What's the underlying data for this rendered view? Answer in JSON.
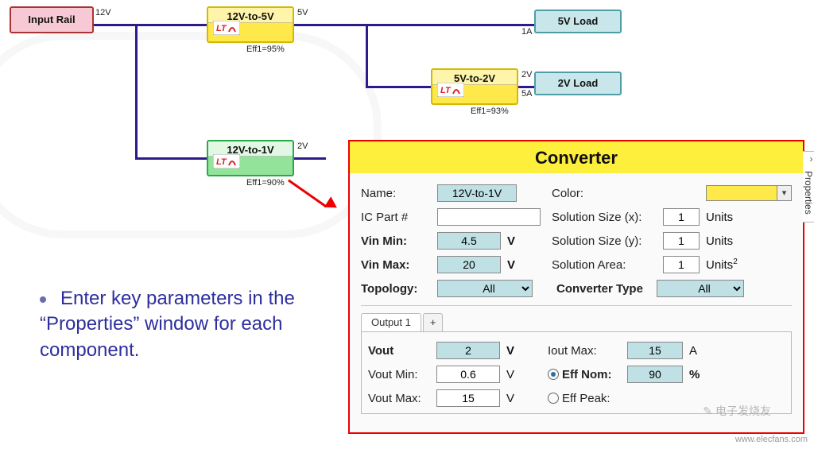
{
  "diagram": {
    "inputRail": {
      "label": "Input Rail",
      "pinRight": "12V"
    },
    "conv12to5": {
      "label": "12V-to-5V",
      "pinRight": "5V",
      "eff": "Eff1=95%"
    },
    "conv5to2": {
      "label": "5V-to-2V",
      "pinRight": "2V",
      "eff": "Eff1=93%"
    },
    "conv12to1": {
      "label": "12V-to-1V",
      "pinRight": "2V",
      "eff": "Eff1=90%"
    },
    "load5": {
      "label": "5V Load",
      "pinLeft": "1A"
    },
    "load2": {
      "label": "2V Load",
      "pinLeft": "5A"
    }
  },
  "bulletText": "Enter key parameters in the “Properties” window for each component.",
  "panel": {
    "title": "Converter",
    "sideTab": "Properties",
    "rows": {
      "name": {
        "label": "Name:",
        "value": "12V-to-1V"
      },
      "color": {
        "label": "Color:",
        "swatch": "#ffe94a"
      },
      "icpart": {
        "label": "IC Part #",
        "value": ""
      },
      "solx": {
        "label": "Solution Size (x):",
        "value": "1",
        "unit": "Units"
      },
      "vinmin": {
        "label": "Vin Min:",
        "value": "4.5",
        "unit": "V"
      },
      "soly": {
        "label": "Solution Size (y):",
        "value": "1",
        "unit": "Units"
      },
      "vinmax": {
        "label": "Vin Max:",
        "value": "20",
        "unit": "V"
      },
      "sola": {
        "label": "Solution Area:",
        "value": "1",
        "unit": "Units",
        "sup": "2"
      },
      "topology": {
        "label": "Topology:",
        "value": "All"
      },
      "convtype": {
        "label": "Converter Type",
        "value": "All"
      }
    },
    "output": {
      "tab": "Output 1",
      "addTab": "+",
      "vout": {
        "label": "Vout",
        "value": "2",
        "unit": "V"
      },
      "ioutmax": {
        "label": "Iout Max:",
        "value": "15",
        "unit": "A"
      },
      "voutmin": {
        "label": "Vout Min:",
        "value": "0.6",
        "unit": "V"
      },
      "effnom": {
        "label": "Eff Nom:",
        "value": "90",
        "unit": "%",
        "selected": true
      },
      "voutmax": {
        "label": "Vout Max:",
        "value": "15",
        "unit": "V"
      },
      "effpeak": {
        "label": "Eff Peak:",
        "value": "",
        "unit": "",
        "selected": false
      }
    }
  },
  "watermark": "www.elecfans.com"
}
